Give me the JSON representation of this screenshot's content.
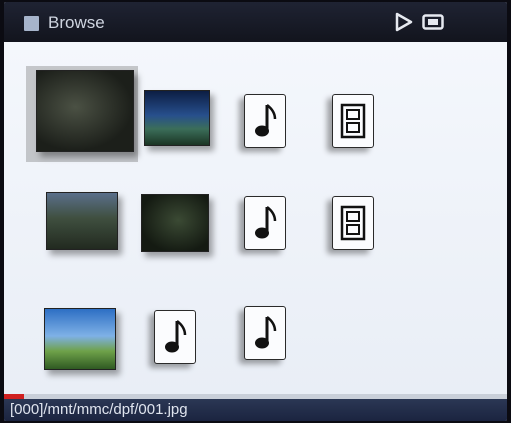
{
  "header": {
    "title": "Browse",
    "icons": [
      "menu-icon",
      "play-icon",
      "memory-card-icon"
    ]
  },
  "grid": {
    "rows": [
      [
        "photo",
        "photo",
        "music",
        "video"
      ],
      [
        "photo",
        "photo",
        "music",
        "video"
      ],
      [
        "photo",
        "music",
        "music"
      ]
    ],
    "selected_index": 0
  },
  "progress": {
    "fraction": 0.04
  },
  "status": {
    "path": "[000]/mnt/mmc/dpf/001.jpg"
  },
  "colors": {
    "progress": "#d02020",
    "statusbar": "#1b2440"
  }
}
